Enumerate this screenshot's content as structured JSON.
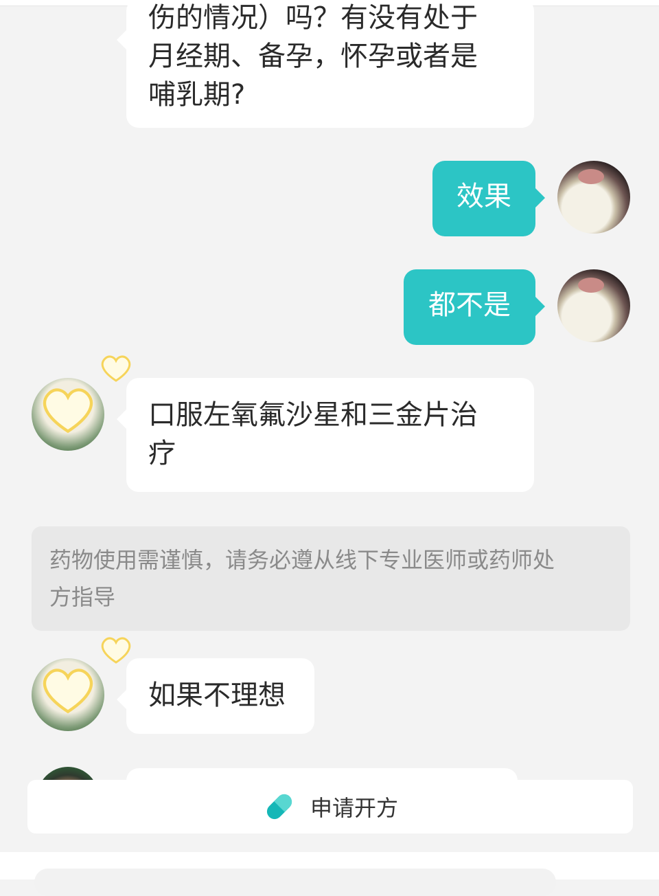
{
  "messages": [
    {
      "side": "in",
      "text_lines": [
        "伤的情况）吗？有没有处于",
        "月经期、备孕，怀孕或者是",
        "哺乳期?"
      ]
    },
    {
      "side": "out",
      "text": "效果"
    },
    {
      "side": "out",
      "text": "都不是"
    },
    {
      "side": "in",
      "text_lines": [
        "口服左氧氟沙星和三金片治",
        "疗"
      ]
    },
    {
      "side": "in",
      "text": "如果不理想"
    }
  ],
  "notice": {
    "lines": [
      "药物使用需谨慎，请务必遵从线下专业医师或药师处",
      "方指导"
    ]
  },
  "action_bar": {
    "label": "申请开方",
    "icon": "pill-icon",
    "icon_colors": [
      "#15b7b7",
      "#58d7d1"
    ]
  },
  "colors": {
    "outgoing_bubble": "#2cc5c5",
    "incoming_bubble": "#ffffff",
    "background": "#f3f3f3"
  }
}
